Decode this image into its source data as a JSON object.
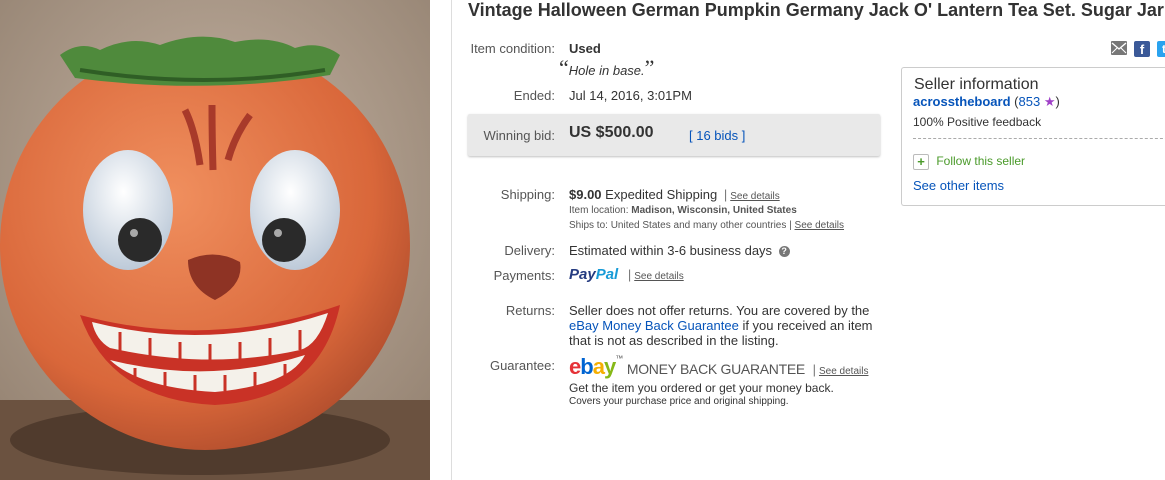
{
  "listing": {
    "title": "Vintage Halloween German Pumpkin Germany Jack O' Lantern Tea Set. Sugar Jar",
    "condition_label": "Item condition:",
    "condition_value": "Used",
    "condition_note": "Hole in base.",
    "ended_label": "Ended:",
    "ended_date": "Jul 14, 2016",
    "ended_sep": ",",
    "ended_time": "3:01PM",
    "winning_label": "Winning bid:",
    "winning_amount": "US $500.00",
    "bids_link": "16 bids",
    "shipping_label": "Shipping:",
    "shipping_cost": "$9.00",
    "shipping_method": "Expedited Shipping",
    "see_details": "See details",
    "item_location_label": "Item location:",
    "item_location": "Madison, Wisconsin, United States",
    "ships_to_label": "Ships to:",
    "ships_to": "United States and many other countries",
    "delivery_label": "Delivery:",
    "delivery_value": "Estimated within 3-6 business days",
    "payments_label": "Payments:",
    "paypal_pay": "Pay",
    "paypal_pal": "Pal",
    "returns_label": "Returns:",
    "returns_text_1": "Seller does not offer returns. You are covered by the",
    "returns_link": "eBay Money Back Guarantee",
    "returns_text_2": " if you received an item",
    "returns_text_3": "that is not as described in the listing.",
    "guarantee_label": "Guarantee:",
    "ebay_letters": [
      "e",
      "b",
      "a",
      "y"
    ],
    "guarantee_tm": "™",
    "guarantee_title": "MONEY BACK GUARANTEE",
    "guarantee_line1": "Get the item you ordered or get your money back.",
    "guarantee_line2": "Covers your purchase price and original shipping."
  },
  "seller": {
    "heading": "Seller information",
    "name": "acrosstheboard",
    "score": "853",
    "feedback": "100% Positive feedback",
    "follow": "Follow this seller",
    "other_items": "See other items"
  },
  "share": {
    "icons": [
      "email-icon",
      "facebook-icon",
      "twitter-icon"
    ],
    "facebook_glyph": "f",
    "twitter_glyph": "t"
  },
  "colors": {
    "link": "#0654ba",
    "paypal_dark": "#253b80",
    "paypal_light": "#179bd7",
    "ebay_e": "#e53238",
    "ebay_b": "#0064d2",
    "ebay_a": "#f5af02",
    "ebay_y": "#86b817",
    "star": "#a040c8",
    "follow_green": "#4a9a2a"
  }
}
